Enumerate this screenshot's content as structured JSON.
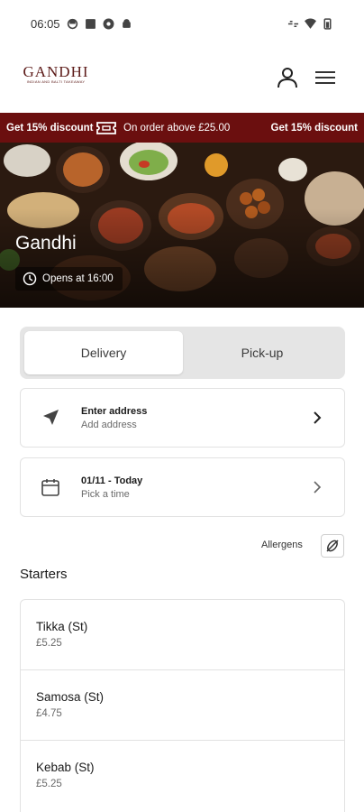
{
  "status_bar": {
    "time": "06:05"
  },
  "header": {
    "logo_title": "GANDHI",
    "logo_subtitle": "INDIAN AND BALTI TAKEAWAY"
  },
  "promo": {
    "left": "Get 15% discount",
    "middle": "On order above £25.00",
    "right": "Get 15% discount"
  },
  "hero": {
    "title": "Gandhi",
    "opens": "Opens at 16:00"
  },
  "order_mode": {
    "delivery": "Delivery",
    "pickup": "Pick-up",
    "selected": "Delivery"
  },
  "address_card": {
    "title": "Enter address",
    "subtitle": "Add address"
  },
  "time_card": {
    "title": "01/11 - Today",
    "subtitle": "Pick a time"
  },
  "allergens_label": "Allergens",
  "section": {
    "title": "Starters"
  },
  "items": [
    {
      "name": "Tikka (St)",
      "price": "£5.25"
    },
    {
      "name": "Samosa (St)",
      "price": "£4.75"
    },
    {
      "name": "Kebab (St)",
      "price": "£5.25"
    }
  ],
  "colors": {
    "promo_bg": "#6b0f0f",
    "logo": "#5c1a18",
    "toggle_bg": "#e5e5e5"
  }
}
